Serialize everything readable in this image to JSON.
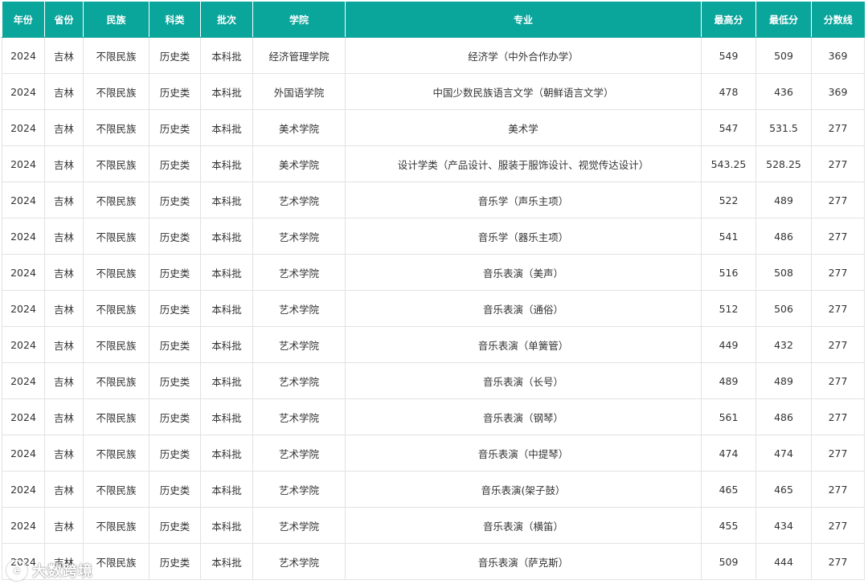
{
  "table": {
    "headers": [
      "年份",
      "省份",
      "民族",
      "科类",
      "批次",
      "学院",
      "专业",
      "最高分",
      "最低分",
      "分数线"
    ],
    "rows": [
      [
        "2024",
        "吉林",
        "不限民族",
        "历史类",
        "本科批",
        "经济管理学院",
        "经济学（中外合作办学）",
        "549",
        "509",
        "369"
      ],
      [
        "2024",
        "吉林",
        "不限民族",
        "历史类",
        "本科批",
        "外国语学院",
        "中国少数民族语言文学（朝鲜语言文学）",
        "478",
        "436",
        "369"
      ],
      [
        "2024",
        "吉林",
        "不限民族",
        "历史类",
        "本科批",
        "美术学院",
        "美术学",
        "547",
        "531.5",
        "277"
      ],
      [
        "2024",
        "吉林",
        "不限民族",
        "历史类",
        "本科批",
        "美术学院",
        "设计学类（产品设计、服装于服饰设计、视觉传达设计）",
        "543.25",
        "528.25",
        "277"
      ],
      [
        "2024",
        "吉林",
        "不限民族",
        "历史类",
        "本科批",
        "艺术学院",
        "音乐学（声乐主项）",
        "522",
        "489",
        "277"
      ],
      [
        "2024",
        "吉林",
        "不限民族",
        "历史类",
        "本科批",
        "艺术学院",
        "音乐学（器乐主项）",
        "541",
        "486",
        "277"
      ],
      [
        "2024",
        "吉林",
        "不限民族",
        "历史类",
        "本科批",
        "艺术学院",
        "音乐表演（美声）",
        "516",
        "508",
        "277"
      ],
      [
        "2024",
        "吉林",
        "不限民族",
        "历史类",
        "本科批",
        "艺术学院",
        "音乐表演（通俗）",
        "512",
        "506",
        "277"
      ],
      [
        "2024",
        "吉林",
        "不限民族",
        "历史类",
        "本科批",
        "艺术学院",
        "音乐表演（单簧管）",
        "449",
        "432",
        "277"
      ],
      [
        "2024",
        "吉林",
        "不限民族",
        "历史类",
        "本科批",
        "艺术学院",
        "音乐表演（长号）",
        "489",
        "489",
        "277"
      ],
      [
        "2024",
        "吉林",
        "不限民族",
        "历史类",
        "本科批",
        "艺术学院",
        "音乐表演（钢琴）",
        "561",
        "486",
        "277"
      ],
      [
        "2024",
        "吉林",
        "不限民族",
        "历史类",
        "本科批",
        "艺术学院",
        "音乐表演（中提琴）",
        "474",
        "474",
        "277"
      ],
      [
        "2024",
        "吉林",
        "不限民族",
        "历史类",
        "本科批",
        "艺术学院",
        "音乐表演(架子鼓）",
        "465",
        "465",
        "277"
      ],
      [
        "2024",
        "吉林",
        "不限民族",
        "历史类",
        "本科批",
        "艺术学院",
        "音乐表演（横笛）",
        "455",
        "434",
        "277"
      ],
      [
        "2024",
        "吉林",
        "不限民族",
        "历史类",
        "本科批",
        "艺术学院",
        "音乐表演（萨克斯）",
        "509",
        "444",
        "277"
      ]
    ]
  },
  "watermark": {
    "icon": "watermark-logo-icon",
    "text": "大数跨境"
  },
  "colors": {
    "header_bg": "#0aa59b",
    "header_text": "#ffffff",
    "cell_text": "#333333",
    "border": "#e2e2e2"
  }
}
